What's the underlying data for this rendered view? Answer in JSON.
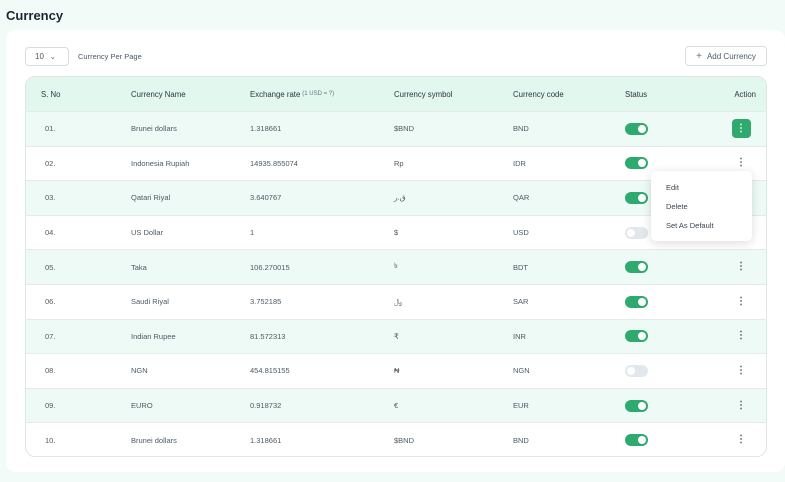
{
  "page": {
    "title": "Currency"
  },
  "toolbar": {
    "per_page_value": "10",
    "per_page_label": "Currency Per Page",
    "add_button": "Add Currency"
  },
  "table": {
    "headers": {
      "sno": "S. No",
      "name": "Currency Name",
      "rate": "Exchange rate",
      "rate_sub": "(1 USD = ?)",
      "symbol": "Currency symbol",
      "code": "Currency code",
      "status": "Status",
      "action": "Action"
    },
    "rows": [
      {
        "sno": "01.",
        "name": "Brunei dollars",
        "rate": "1.318661",
        "symbol": "$BND",
        "code": "BND",
        "status": "on"
      },
      {
        "sno": "02.",
        "name": "Indonesia Rupiah",
        "rate": "14935.855074",
        "symbol": "Rp",
        "code": "IDR",
        "status": "on"
      },
      {
        "sno": "03.",
        "name": "Qatari Riyal",
        "rate": "3.640767",
        "symbol": "ق.ر",
        "code": "QAR",
        "status": "on"
      },
      {
        "sno": "04.",
        "name": "US Dollar",
        "rate": "1",
        "symbol": "$",
        "code": "USD",
        "status": "off"
      },
      {
        "sno": "05.",
        "name": "Taka",
        "rate": "106.270015",
        "symbol": "৳",
        "code": "BDT",
        "status": "on"
      },
      {
        "sno": "06.",
        "name": "Saudi Riyal",
        "rate": "3.752185",
        "symbol": "﷼",
        "code": "SAR",
        "status": "on"
      },
      {
        "sno": "07.",
        "name": "Indian Rupee",
        "rate": "81.572313",
        "symbol": "₹",
        "code": "INR",
        "status": "on"
      },
      {
        "sno": "08.",
        "name": "NGN",
        "rate": "454.815155",
        "symbol": "₦",
        "code": "NGN",
        "status": "off"
      },
      {
        "sno": "09.",
        "name": "EURO",
        "rate": "0.918732",
        "symbol": "€",
        "code": "EUR",
        "status": "on"
      },
      {
        "sno": "10.",
        "name": "Brunei dollars",
        "rate": "1.318661",
        "symbol": "$BND",
        "code": "BND",
        "status": "on"
      }
    ]
  },
  "action_menu": {
    "open_row": 1,
    "items": [
      "Edit",
      "Delete",
      "Set As Default"
    ]
  },
  "colors": {
    "accent": "#2eaa6e",
    "header_bg": "#e2f7ee",
    "row_alt": "#eefaf5",
    "toggle_off": "#e2e7ee"
  },
  "icons": {
    "chevron": "chevron-down-icon",
    "add": "plus-icon",
    "row_action": "kebab-icon"
  }
}
